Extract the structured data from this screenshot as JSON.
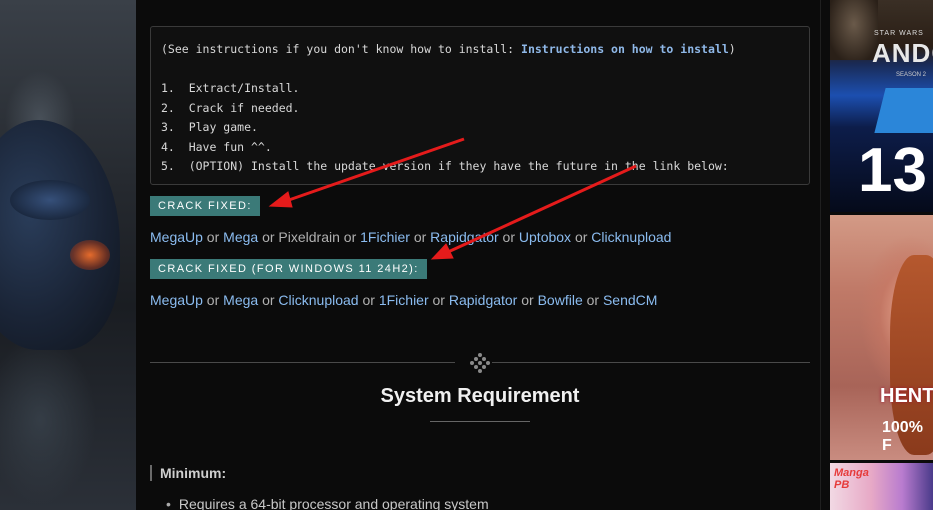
{
  "instructions": {
    "intro_prefix": "(See instructions if you don't know how to install: ",
    "intro_link": "Instructions on how to install",
    "intro_suffix": ")",
    "steps": [
      "1.  Extract/Install.",
      "2.  Crack if needed.",
      "3.  Play game.",
      "4.  Have fun ^^.",
      "5.  (OPTION) Install the update version if they have the future in the link below:"
    ]
  },
  "crack_fixed": {
    "label": "CRACK FIXED:",
    "links": [
      "MegaUp",
      "Mega",
      "Pixeldrain",
      "1Fichier",
      "Rapidgator",
      "Uptobox",
      "Clicknupload"
    ],
    "separator": " or "
  },
  "crack_fixed_win11": {
    "label": "CRACK FIXED (FOR WINDOWS 11 24H2):",
    "links": [
      "MegaUp",
      "Mega",
      "Clicknupload",
      "1Fichier",
      "Rapidgator",
      "Bowfile",
      "SendCM"
    ],
    "separator": " or "
  },
  "system_requirement": {
    "title": "System Requirement",
    "minimum_label": "Minimum:",
    "items": [
      "Requires a 64-bit processor and operating system"
    ]
  },
  "ads": {
    "ad1": {
      "brand_top": "STAR WARS",
      "brand": "ANDOR",
      "season": "SEASON 2",
      "number": "13"
    },
    "ad2": {
      "title": "HENT",
      "subtitle": "100% F"
    },
    "ad3": {
      "logo": "Manga\nPB"
    }
  },
  "colors": {
    "label_bg": "#3b7a78",
    "link": "#8bbcf0",
    "arrow": "#e51b1b",
    "background": "#0b0b0b"
  }
}
